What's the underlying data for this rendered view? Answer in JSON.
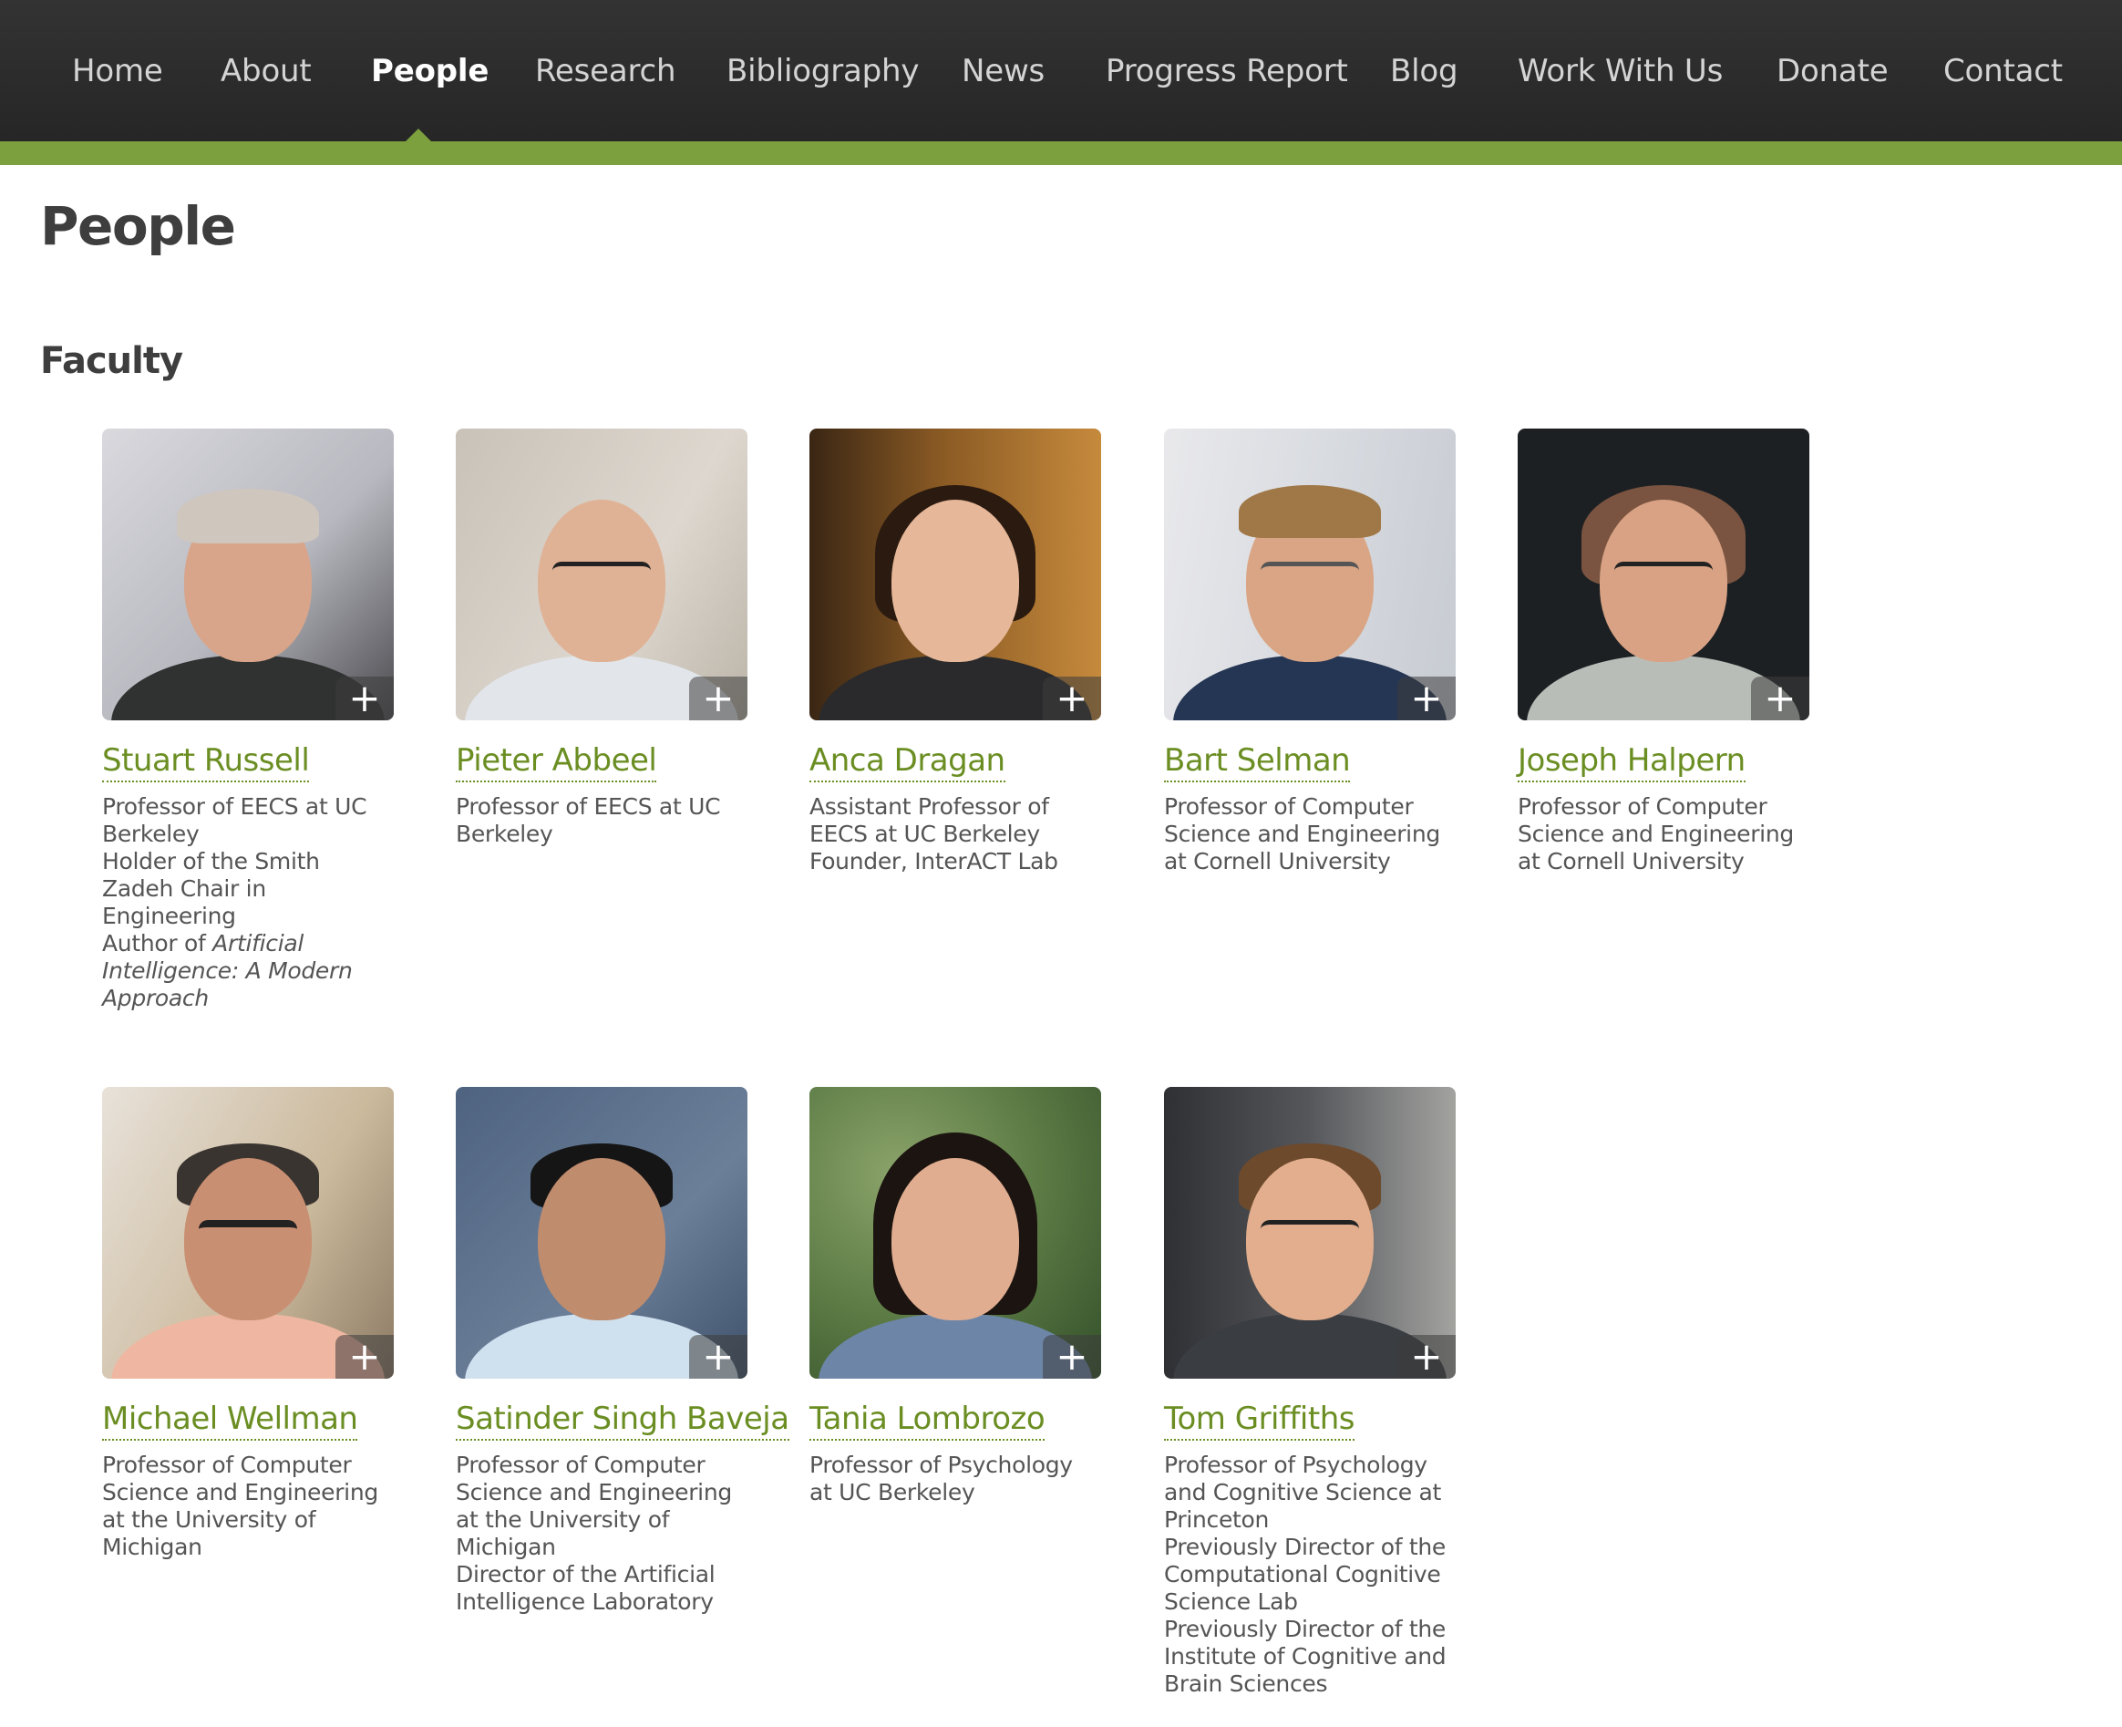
{
  "nav": {
    "items": [
      {
        "label": "Home"
      },
      {
        "label": "About"
      },
      {
        "label": "People",
        "active": true
      },
      {
        "label": "Research"
      },
      {
        "label": "Bibliography"
      },
      {
        "label": "News"
      },
      {
        "label": "Progress Report"
      },
      {
        "label": "Blog"
      },
      {
        "label": "Work With Us"
      },
      {
        "label": "Donate"
      },
      {
        "label": "Contact"
      }
    ]
  },
  "colors": {
    "nav_background": "#2b2b2b",
    "accent_green": "#7ba03d",
    "link_green": "#6b8e23"
  },
  "page": {
    "title": "People",
    "section_title": "Faculty"
  },
  "faculty": [
    {
      "name": "Stuart Russell",
      "bio": [
        "Professor of EECS at UC Berkeley",
        "Holder of the Smith Zadeh Chair in Engineering"
      ],
      "bio_author_prefix": "Author of ",
      "bio_book_title": "Artificial Intelligence: A Modern Approach",
      "photo_icon": "portrait-photo",
      "expand_icon": "plus-icon"
    },
    {
      "name": "Pieter Abbeel",
      "bio": [
        "Professor of EECS at UC Berkeley"
      ],
      "photo_icon": "portrait-photo",
      "expand_icon": "plus-icon"
    },
    {
      "name": "Anca Dragan",
      "bio": [
        "Assistant Professor of EECS at UC Berkeley",
        "Founder, InterACT Lab"
      ],
      "photo_icon": "portrait-photo",
      "expand_icon": "plus-icon"
    },
    {
      "name": "Bart Selman",
      "bio": [
        "Professor of Computer Science and Engineering at Cornell University"
      ],
      "photo_icon": "portrait-photo",
      "expand_icon": "plus-icon"
    },
    {
      "name": "Joseph Halpern",
      "bio": [
        "Professor of Computer Science and Engineering at Cornell University"
      ],
      "photo_icon": "portrait-photo",
      "expand_icon": "plus-icon"
    },
    {
      "name": "Michael Wellman",
      "bio": [
        "Professor of Computer Science and Engineering at the University of Michigan"
      ],
      "photo_icon": "portrait-photo",
      "expand_icon": "plus-icon"
    },
    {
      "name": "Satinder Singh Baveja",
      "bio": [
        "Professor of Computer Science and Engineering at the University of Michigan",
        "Director of the Artificial Intelligence Laboratory"
      ],
      "photo_icon": "portrait-photo",
      "expand_icon": "plus-icon"
    },
    {
      "name": "Tania Lombrozo",
      "bio": [
        "Professor of Psychology at UC Berkeley"
      ],
      "photo_icon": "portrait-photo",
      "expand_icon": "plus-icon"
    },
    {
      "name": "Tom Griffiths",
      "bio": [
        "Professor of Psychology and Cognitive Science at Princeton",
        "Previously Director of the Computational Cognitive Science Lab",
        "Previously Director of the Institute of Cognitive and Brain Sciences"
      ],
      "photo_icon": "portrait-photo",
      "expand_icon": "plus-icon"
    }
  ]
}
